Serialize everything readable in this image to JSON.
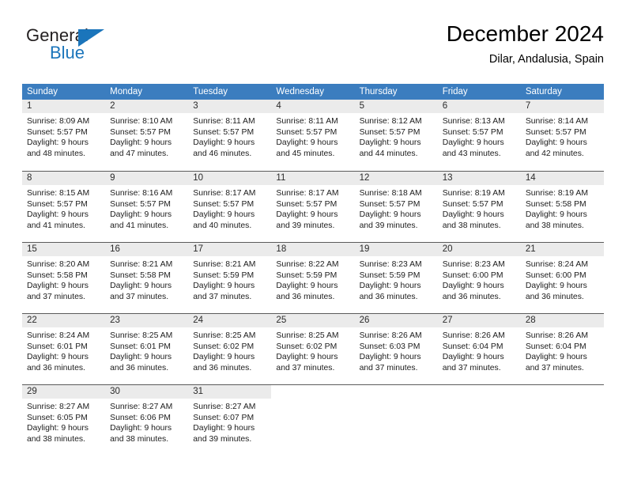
{
  "brand": {
    "word_one": "General",
    "word_two": "Blue",
    "logo_icon": "triangle-logo-icon",
    "accent_color": "#1b75bb"
  },
  "header": {
    "title": "December 2024",
    "subtitle": "Dilar, Andalusia, Spain"
  },
  "theme": {
    "header_row_bg": "#3b7dbf",
    "day_band_bg": "#ebebeb",
    "row_divider": "#5b5b5b",
    "text": "#000000"
  },
  "weekdays": [
    "Sunday",
    "Monday",
    "Tuesday",
    "Wednesday",
    "Thursday",
    "Friday",
    "Saturday"
  ],
  "weeks": [
    [
      {
        "day": "1",
        "sunrise": "Sunrise: 8:09 AM",
        "sunset": "Sunset: 5:57 PM",
        "daylight1": "Daylight: 9 hours",
        "daylight2": "and 48 minutes."
      },
      {
        "day": "2",
        "sunrise": "Sunrise: 8:10 AM",
        "sunset": "Sunset: 5:57 PM",
        "daylight1": "Daylight: 9 hours",
        "daylight2": "and 47 minutes."
      },
      {
        "day": "3",
        "sunrise": "Sunrise: 8:11 AM",
        "sunset": "Sunset: 5:57 PM",
        "daylight1": "Daylight: 9 hours",
        "daylight2": "and 46 minutes."
      },
      {
        "day": "4",
        "sunrise": "Sunrise: 8:11 AM",
        "sunset": "Sunset: 5:57 PM",
        "daylight1": "Daylight: 9 hours",
        "daylight2": "and 45 minutes."
      },
      {
        "day": "5",
        "sunrise": "Sunrise: 8:12 AM",
        "sunset": "Sunset: 5:57 PM",
        "daylight1": "Daylight: 9 hours",
        "daylight2": "and 44 minutes."
      },
      {
        "day": "6",
        "sunrise": "Sunrise: 8:13 AM",
        "sunset": "Sunset: 5:57 PM",
        "daylight1": "Daylight: 9 hours",
        "daylight2": "and 43 minutes."
      },
      {
        "day": "7",
        "sunrise": "Sunrise: 8:14 AM",
        "sunset": "Sunset: 5:57 PM",
        "daylight1": "Daylight: 9 hours",
        "daylight2": "and 42 minutes."
      }
    ],
    [
      {
        "day": "8",
        "sunrise": "Sunrise: 8:15 AM",
        "sunset": "Sunset: 5:57 PM",
        "daylight1": "Daylight: 9 hours",
        "daylight2": "and 41 minutes."
      },
      {
        "day": "9",
        "sunrise": "Sunrise: 8:16 AM",
        "sunset": "Sunset: 5:57 PM",
        "daylight1": "Daylight: 9 hours",
        "daylight2": "and 41 minutes."
      },
      {
        "day": "10",
        "sunrise": "Sunrise: 8:17 AM",
        "sunset": "Sunset: 5:57 PM",
        "daylight1": "Daylight: 9 hours",
        "daylight2": "and 40 minutes."
      },
      {
        "day": "11",
        "sunrise": "Sunrise: 8:17 AM",
        "sunset": "Sunset: 5:57 PM",
        "daylight1": "Daylight: 9 hours",
        "daylight2": "and 39 minutes."
      },
      {
        "day": "12",
        "sunrise": "Sunrise: 8:18 AM",
        "sunset": "Sunset: 5:57 PM",
        "daylight1": "Daylight: 9 hours",
        "daylight2": "and 39 minutes."
      },
      {
        "day": "13",
        "sunrise": "Sunrise: 8:19 AM",
        "sunset": "Sunset: 5:57 PM",
        "daylight1": "Daylight: 9 hours",
        "daylight2": "and 38 minutes."
      },
      {
        "day": "14",
        "sunrise": "Sunrise: 8:19 AM",
        "sunset": "Sunset: 5:58 PM",
        "daylight1": "Daylight: 9 hours",
        "daylight2": "and 38 minutes."
      }
    ],
    [
      {
        "day": "15",
        "sunrise": "Sunrise: 8:20 AM",
        "sunset": "Sunset: 5:58 PM",
        "daylight1": "Daylight: 9 hours",
        "daylight2": "and 37 minutes."
      },
      {
        "day": "16",
        "sunrise": "Sunrise: 8:21 AM",
        "sunset": "Sunset: 5:58 PM",
        "daylight1": "Daylight: 9 hours",
        "daylight2": "and 37 minutes."
      },
      {
        "day": "17",
        "sunrise": "Sunrise: 8:21 AM",
        "sunset": "Sunset: 5:59 PM",
        "daylight1": "Daylight: 9 hours",
        "daylight2": "and 37 minutes."
      },
      {
        "day": "18",
        "sunrise": "Sunrise: 8:22 AM",
        "sunset": "Sunset: 5:59 PM",
        "daylight1": "Daylight: 9 hours",
        "daylight2": "and 36 minutes."
      },
      {
        "day": "19",
        "sunrise": "Sunrise: 8:23 AM",
        "sunset": "Sunset: 5:59 PM",
        "daylight1": "Daylight: 9 hours",
        "daylight2": "and 36 minutes."
      },
      {
        "day": "20",
        "sunrise": "Sunrise: 8:23 AM",
        "sunset": "Sunset: 6:00 PM",
        "daylight1": "Daylight: 9 hours",
        "daylight2": "and 36 minutes."
      },
      {
        "day": "21",
        "sunrise": "Sunrise: 8:24 AM",
        "sunset": "Sunset: 6:00 PM",
        "daylight1": "Daylight: 9 hours",
        "daylight2": "and 36 minutes."
      }
    ],
    [
      {
        "day": "22",
        "sunrise": "Sunrise: 8:24 AM",
        "sunset": "Sunset: 6:01 PM",
        "daylight1": "Daylight: 9 hours",
        "daylight2": "and 36 minutes."
      },
      {
        "day": "23",
        "sunrise": "Sunrise: 8:25 AM",
        "sunset": "Sunset: 6:01 PM",
        "daylight1": "Daylight: 9 hours",
        "daylight2": "and 36 minutes."
      },
      {
        "day": "24",
        "sunrise": "Sunrise: 8:25 AM",
        "sunset": "Sunset: 6:02 PM",
        "daylight1": "Daylight: 9 hours",
        "daylight2": "and 36 minutes."
      },
      {
        "day": "25",
        "sunrise": "Sunrise: 8:25 AM",
        "sunset": "Sunset: 6:02 PM",
        "daylight1": "Daylight: 9 hours",
        "daylight2": "and 37 minutes."
      },
      {
        "day": "26",
        "sunrise": "Sunrise: 8:26 AM",
        "sunset": "Sunset: 6:03 PM",
        "daylight1": "Daylight: 9 hours",
        "daylight2": "and 37 minutes."
      },
      {
        "day": "27",
        "sunrise": "Sunrise: 8:26 AM",
        "sunset": "Sunset: 6:04 PM",
        "daylight1": "Daylight: 9 hours",
        "daylight2": "and 37 minutes."
      },
      {
        "day": "28",
        "sunrise": "Sunrise: 8:26 AM",
        "sunset": "Sunset: 6:04 PM",
        "daylight1": "Daylight: 9 hours",
        "daylight2": "and 37 minutes."
      }
    ],
    [
      {
        "day": "29",
        "sunrise": "Sunrise: 8:27 AM",
        "sunset": "Sunset: 6:05 PM",
        "daylight1": "Daylight: 9 hours",
        "daylight2": "and 38 minutes."
      },
      {
        "day": "30",
        "sunrise": "Sunrise: 8:27 AM",
        "sunset": "Sunset: 6:06 PM",
        "daylight1": "Daylight: 9 hours",
        "daylight2": "and 38 minutes."
      },
      {
        "day": "31",
        "sunrise": "Sunrise: 8:27 AM",
        "sunset": "Sunset: 6:07 PM",
        "daylight1": "Daylight: 9 hours",
        "daylight2": "and 39 minutes."
      },
      {
        "day": "",
        "sunrise": "",
        "sunset": "",
        "daylight1": "",
        "daylight2": ""
      },
      {
        "day": "",
        "sunrise": "",
        "sunset": "",
        "daylight1": "",
        "daylight2": ""
      },
      {
        "day": "",
        "sunrise": "",
        "sunset": "",
        "daylight1": "",
        "daylight2": ""
      },
      {
        "day": "",
        "sunrise": "",
        "sunset": "",
        "daylight1": "",
        "daylight2": ""
      }
    ]
  ]
}
